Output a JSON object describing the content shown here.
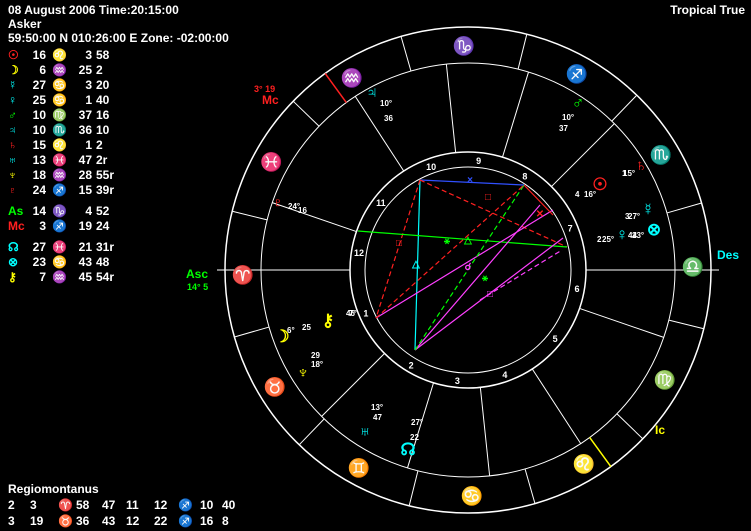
{
  "header": {
    "date_time": "08 August 2006 Time:20:15:00",
    "name": "Asker",
    "location": "59:50:00 N 010:26:00 E  Zone: -02:00:00",
    "zodiac": "Tropical True"
  },
  "colors": {
    "sun": "#ff2020",
    "moon": "#ffff00",
    "mercury": "#00ffff",
    "venus": "#00ffff",
    "mars": "#00ff00",
    "jupiter": "#00ffff",
    "saturn": "#ff2020",
    "uranus": "#00ffff",
    "neptune": "#ffff00",
    "pluto": "#ff2020",
    "asc": "#00ff00",
    "mc": "#ff2020",
    "node": "#00ffff",
    "fortune": "#00ffff",
    "chiron": "#ffff00"
  },
  "planets": [
    {
      "icon": "sun-icon",
      "glyph": "☉",
      "color": "#ff2020",
      "deg": "16",
      "sign_icon": "leo-icon",
      "sign": "♌",
      "sign_color": "#ff2020",
      "d2": "3",
      "min": "58"
    },
    {
      "icon": "moon-icon",
      "glyph": "☽",
      "color": "#ffff00",
      "deg": "6",
      "sign_icon": "aquarius-icon",
      "sign": "♒",
      "sign_color": "#ffff00",
      "d2": "25",
      "min": "2"
    },
    {
      "icon": "mercury-icon",
      "glyph": "☿",
      "color": "#00ffff",
      "deg": "27",
      "sign_icon": "cancer-icon",
      "sign": "♋",
      "sign_color": "#00ffff",
      "d2": "3",
      "min": "20"
    },
    {
      "icon": "venus-icon",
      "glyph": "♀",
      "color": "#00ffff",
      "deg": "25",
      "sign_icon": "cancer-icon",
      "sign": "♋",
      "sign_color": "#00ffff",
      "d2": "1",
      "min": "40"
    },
    {
      "icon": "mars-icon",
      "glyph": "♂",
      "color": "#00ff00",
      "deg": "10",
      "sign_icon": "virgo-icon",
      "sign": "♍",
      "sign_color": "#00ff00",
      "d2": "37",
      "min": "16"
    },
    {
      "icon": "jupiter-icon",
      "glyph": "♃",
      "color": "#00ffff",
      "deg": "10",
      "sign_icon": "scorpio-icon",
      "sign": "♏",
      "sign_color": "#00ffff",
      "d2": "36",
      "min": "10"
    },
    {
      "icon": "saturn-icon",
      "glyph": "♄",
      "color": "#ff2020",
      "deg": "15",
      "sign_icon": "leo-icon",
      "sign": "♌",
      "sign_color": "#ff2020",
      "d2": "1",
      "min": "2"
    },
    {
      "icon": "uranus-icon",
      "glyph": "♅",
      "color": "#00ffff",
      "deg": "13",
      "sign_icon": "pisces-icon",
      "sign": "♓",
      "sign_color": "#00ffff",
      "d2": "47",
      "min": "2r"
    },
    {
      "icon": "neptune-icon",
      "glyph": "♆",
      "color": "#ffff00",
      "deg": "18",
      "sign_icon": "aquarius-icon",
      "sign": "♒",
      "sign_color": "#ffff00",
      "d2": "28",
      "min": "55r"
    },
    {
      "icon": "pluto-icon",
      "glyph": "♇",
      "color": "#ff2020",
      "deg": "24",
      "sign_icon": "sagittarius-icon",
      "sign": "♐",
      "sign_color": "#ff2020",
      "d2": "15",
      "min": "39r"
    },
    {
      "icon": "ascendant-label",
      "glyph": "As",
      "color": "#00ff00",
      "deg": "14",
      "sign_icon": "capricorn-icon",
      "sign": "♑",
      "sign_color": "#00ff00",
      "d2": "4",
      "min": "52"
    },
    {
      "icon": "midheaven-label",
      "glyph": "Mc",
      "color": "#ff2020",
      "deg": "3",
      "sign_icon": "sagittarius-icon",
      "sign": "♐",
      "sign_color": "#ff2020",
      "d2": "19",
      "min": "24"
    },
    {
      "icon": "node-icon",
      "glyph": "☊",
      "color": "#00ffff",
      "deg": "27",
      "sign_icon": "pisces-icon",
      "sign": "♓",
      "sign_color": "#00ffff",
      "d2": "21",
      "min": "31r"
    },
    {
      "icon": "fortune-icon",
      "glyph": "⊗",
      "color": "#00ffff",
      "deg": "23",
      "sign_icon": "cancer-icon",
      "sign": "♋",
      "sign_color": "#00ffff",
      "d2": "43",
      "min": "48"
    },
    {
      "icon": "chiron-icon",
      "glyph": "⚷",
      "color": "#ffff00",
      "deg": "7",
      "sign_icon": "aquarius-icon",
      "sign": "♒",
      "sign_color": "#ffff00",
      "d2": "45",
      "min": "54r"
    }
  ],
  "house_system": "Regiomontanus",
  "house_rows": [
    {
      "h1": "2",
      "d1": "3",
      "s1": "♈",
      "s1_icon": "aries-icon",
      "s1_color": "#ff2020",
      "m1": "58",
      "m2": "47",
      "h2": "11",
      "d2": "12",
      "s2": "♐",
      "s2_icon": "sagittarius-icon",
      "s2_color": "#ff2020",
      "m3": "10",
      "m4": "40"
    },
    {
      "h1": "3",
      "d1": "19",
      "s1": "♉",
      "s1_icon": "taurus-icon",
      "s1_color": "#00ff00",
      "m1": "36",
      "m2": "43",
      "h2": "12",
      "d2": "22",
      "s2": "♐",
      "s2_icon": "sagittarius-icon",
      "s2_color": "#ff2020",
      "m3": "16",
      "m4": "8"
    }
  ],
  "wheel": {
    "labels": {
      "asc": "Asc",
      "asc_deg": "14° 5",
      "des": "Des",
      "mc": "Mc",
      "mc_deg": "3° 19",
      "ic": "Ic"
    },
    "house_numbers": [
      "1",
      "2",
      "3",
      "4",
      "5",
      "6",
      "7",
      "8",
      "9",
      "10",
      "11",
      "12"
    ],
    "signs": [
      {
        "icon": "aries-icon",
        "glyph": "♈",
        "color": "#ff2020"
      },
      {
        "icon": "taurus-icon",
        "glyph": "♉",
        "color": "#00ff00"
      },
      {
        "icon": "gemini-icon",
        "glyph": "♊",
        "color": "#ffff00"
      },
      {
        "icon": "cancer-icon",
        "glyph": "♋",
        "color": "#00ffff"
      },
      {
        "icon": "leo-icon",
        "glyph": "♌",
        "color": "#ff2020"
      },
      {
        "icon": "virgo-icon",
        "glyph": "♍",
        "color": "#00ff00"
      },
      {
        "icon": "libra-icon",
        "glyph": "♎",
        "color": "#ffff00"
      },
      {
        "icon": "scorpio-icon",
        "glyph": "♏",
        "color": "#00ffff"
      },
      {
        "icon": "sagittarius-icon",
        "glyph": "♐",
        "color": "#ff2020"
      },
      {
        "icon": "capricorn-icon",
        "glyph": "♑",
        "color": "#00ff00"
      },
      {
        "icon": "aquarius-icon",
        "glyph": "♒",
        "color": "#ffff00"
      },
      {
        "icon": "pisces-icon",
        "glyph": "♓",
        "color": "#00ffff"
      }
    ],
    "planet_marks": [
      {
        "icon": "jupiter-icon",
        "glyph": "♃",
        "color": "#00ffff",
        "deg": "10°",
        "min": "36"
      },
      {
        "icon": "mars-icon",
        "glyph": "♂",
        "color": "#00ff00",
        "deg": "10°",
        "min": "37"
      },
      {
        "icon": "sun-icon",
        "glyph": "☉",
        "color": "#ff2020",
        "deg": "16°",
        "min": "4"
      },
      {
        "icon": "saturn-icon",
        "glyph": "♄",
        "color": "#ff2020",
        "deg": "15°",
        "min": "1"
      },
      {
        "icon": "mercury-icon",
        "glyph": "☿",
        "color": "#00ffff",
        "deg": "27°",
        "min": "3"
      },
      {
        "icon": "fortune-icon",
        "glyph": "⊗",
        "color": "#00ffff",
        "deg": "23°",
        "min": "44"
      },
      {
        "icon": "venus-icon",
        "glyph": "♀",
        "color": "#00ffff",
        "deg": "25°",
        "min": "2"
      },
      {
        "icon": "pluto-icon",
        "glyph": "♇",
        "color": "#ff2020",
        "deg": "24°",
        "min": "16"
      },
      {
        "icon": "moon-icon",
        "glyph": "☽",
        "color": "#ffff00",
        "deg": "6°",
        "min": "25"
      },
      {
        "icon": "chiron-icon",
        "glyph": "⚷",
        "color": "#ffff00",
        "deg": "7°",
        "min": "46"
      },
      {
        "icon": "neptune-icon",
        "glyph": "♆",
        "color": "#ffff00",
        "deg": "18°",
        "min": "29"
      },
      {
        "icon": "uranus-icon",
        "glyph": "♅",
        "color": "#00ffff",
        "deg": "13°",
        "min": "47"
      },
      {
        "icon": "node-icon",
        "glyph": "☊",
        "color": "#00ffff",
        "deg": "27°",
        "min": "22"
      }
    ]
  }
}
